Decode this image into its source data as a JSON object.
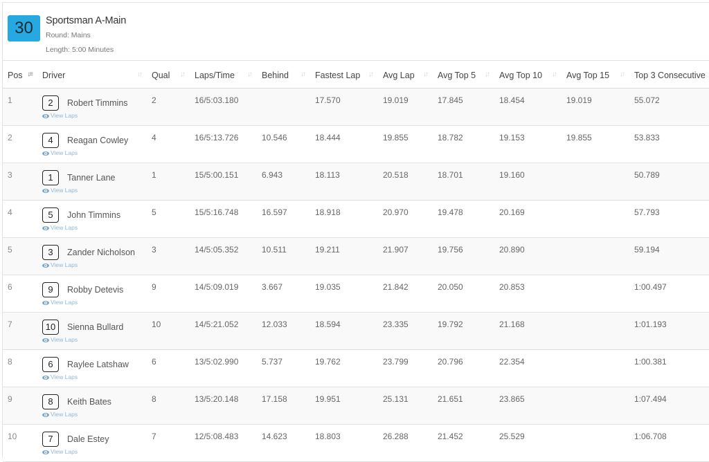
{
  "race": {
    "number": "30",
    "title": "Sportsman A-Main",
    "round": "Round: Mains",
    "length": "Length: 5:00 Minutes"
  },
  "columns": {
    "pos": "Pos",
    "driver": "Driver",
    "qual": "Qual",
    "laps_time": "Laps/Time",
    "behind": "Behind",
    "fastest_lap": "Fastest Lap",
    "avg_lap": "Avg Lap",
    "avg_top5": "Avg Top 5",
    "avg_top10": "Avg Top 10",
    "avg_top15": "Avg Top 15",
    "top3_consecutive": "Top 3 Consecutive"
  },
  "view_laps_label": "View Laps",
  "rows": [
    {
      "pos": "1",
      "car": "2",
      "driver": "Robert Timmins",
      "qual": "2",
      "laps_time": "16/5:03.180",
      "behind": "",
      "fastest_lap": "17.570",
      "avg_lap": "19.019",
      "avg_top5": "17.845",
      "avg_top10": "18.454",
      "avg_top15": "19.019",
      "top3": "55.072"
    },
    {
      "pos": "2",
      "car": "4",
      "driver": "Reagan Cowley",
      "qual": "4",
      "laps_time": "16/5:13.726",
      "behind": "10.546",
      "fastest_lap": "18.444",
      "avg_lap": "19.855",
      "avg_top5": "18.782",
      "avg_top10": "19.153",
      "avg_top15": "19.855",
      "top3": "53.833"
    },
    {
      "pos": "3",
      "car": "1",
      "driver": "Tanner Lane",
      "qual": "1",
      "laps_time": "15/5:00.151",
      "behind": "6.943",
      "fastest_lap": "18.113",
      "avg_lap": "20.518",
      "avg_top5": "18.701",
      "avg_top10": "19.160",
      "avg_top15": "",
      "top3": "50.789"
    },
    {
      "pos": "4",
      "car": "5",
      "driver": "John Timmins",
      "qual": "5",
      "laps_time": "15/5:16.748",
      "behind": "16.597",
      "fastest_lap": "18.918",
      "avg_lap": "20.970",
      "avg_top5": "19.478",
      "avg_top10": "20.169",
      "avg_top15": "",
      "top3": "57.793"
    },
    {
      "pos": "5",
      "car": "3",
      "driver": "Zander Nicholson",
      "qual": "3",
      "laps_time": "14/5:05.352",
      "behind": "10.511",
      "fastest_lap": "19.211",
      "avg_lap": "21.907",
      "avg_top5": "19.756",
      "avg_top10": "20.890",
      "avg_top15": "",
      "top3": "59.194"
    },
    {
      "pos": "6",
      "car": "9",
      "driver": "Robby Detevis",
      "qual": "9",
      "laps_time": "14/5:09.019",
      "behind": "3.667",
      "fastest_lap": "19.035",
      "avg_lap": "21.842",
      "avg_top5": "20.050",
      "avg_top10": "20.853",
      "avg_top15": "",
      "top3": "1:00.497"
    },
    {
      "pos": "7",
      "car": "10",
      "driver": "Sienna Bullard",
      "qual": "10",
      "laps_time": "14/5:21.052",
      "behind": "12.033",
      "fastest_lap": "18.594",
      "avg_lap": "23.335",
      "avg_top5": "19.792",
      "avg_top10": "21.168",
      "avg_top15": "",
      "top3": "1:01.193"
    },
    {
      "pos": "8",
      "car": "6",
      "driver": "Raylee Latshaw",
      "qual": "6",
      "laps_time": "13/5:02.990",
      "behind": "5.737",
      "fastest_lap": "19.762",
      "avg_lap": "23.799",
      "avg_top5": "20.796",
      "avg_top10": "22.354",
      "avg_top15": "",
      "top3": "1:00.381"
    },
    {
      "pos": "9",
      "car": "8",
      "driver": "Keith Bates",
      "qual": "8",
      "laps_time": "13/5:20.148",
      "behind": "17.158",
      "fastest_lap": "19.951",
      "avg_lap": "25.131",
      "avg_top5": "21.651",
      "avg_top10": "23.865",
      "avg_top15": "",
      "top3": "1:07.494"
    },
    {
      "pos": "10",
      "car": "7",
      "driver": "Dale Estey",
      "qual": "7",
      "laps_time": "12/5:08.483",
      "behind": "14.623",
      "fastest_lap": "18.803",
      "avg_lap": "26.288",
      "avg_top5": "21.452",
      "avg_top10": "25.529",
      "avg_top15": "",
      "top3": "1:06.708"
    }
  ],
  "colors": {
    "race_badge": "#26a9e0",
    "link": "#8fb8d6"
  }
}
